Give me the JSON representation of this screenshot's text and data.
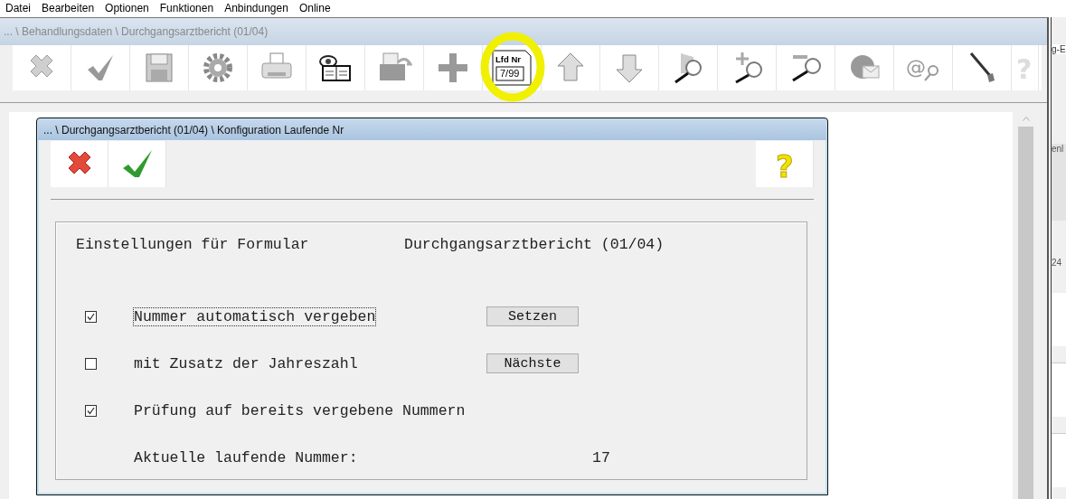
{
  "menu": [
    {
      "label": "Datei"
    },
    {
      "label": "Bearbeiten"
    },
    {
      "label": "Optionen"
    },
    {
      "label": "Funktionen"
    },
    {
      "label": "Anbindungen"
    },
    {
      "label": "Online"
    }
  ],
  "main_window": {
    "title": "... \\ Behandlungsdaten \\ Durchgangsarztbericht (01/04)",
    "toolbar": [
      {
        "kind": "delete",
        "highlighted": false
      },
      {
        "kind": "check",
        "highlighted": false
      },
      {
        "kind": "save",
        "highlighted": false
      },
      {
        "kind": "gear",
        "highlighted": false
      },
      {
        "kind": "printer",
        "highlighted": false
      },
      {
        "kind": "eye-book",
        "highlighted": false
      },
      {
        "kind": "folder",
        "highlighted": false
      },
      {
        "kind": "plus",
        "highlighted": false
      },
      {
        "kind": "number",
        "highlighted": true,
        "label_top": "Lfd Nr",
        "label_bottom": "7/99"
      },
      {
        "kind": "up",
        "highlighted": false
      },
      {
        "kind": "down",
        "highlighted": false
      },
      {
        "kind": "doc-search",
        "highlighted": false
      },
      {
        "kind": "zoom-in",
        "highlighted": false
      },
      {
        "kind": "zoom-out",
        "highlighted": false
      },
      {
        "kind": "globe-mail",
        "highlighted": false
      },
      {
        "kind": "at-search",
        "highlighted": false,
        "glyph": "@"
      },
      {
        "kind": "pen",
        "highlighted": false
      },
      {
        "kind": "help",
        "highlighted": false,
        "glyph": "?"
      }
    ]
  },
  "background_window": {
    "texts": [
      "g-E",
      "enl",
      "24"
    ]
  },
  "dialog": {
    "title": "... \\ Durchgangsarztbericht (01/04) \\ Konfiguration Laufende Nr",
    "toolbar": [
      {
        "kind": "cancel"
      },
      {
        "kind": "ok"
      },
      {
        "kind": "help",
        "glyph": "?"
      }
    ],
    "form_label": "Einstellungen für Formular",
    "form_value": "Durchgangsarztbericht (01/04)",
    "options": [
      {
        "label": "Nummer automatisch vergeben",
        "checked": true,
        "focused": true,
        "button": "Setzen"
      },
      {
        "label": "mit Zusatz der Jahreszahl",
        "checked": false,
        "focused": false,
        "button": "Nächste"
      },
      {
        "label": "Prüfung auf bereits vergebene Nummern",
        "checked": true,
        "focused": false
      }
    ],
    "current_label": "Aktuelle laufende Nummer:",
    "current_value": "17"
  }
}
